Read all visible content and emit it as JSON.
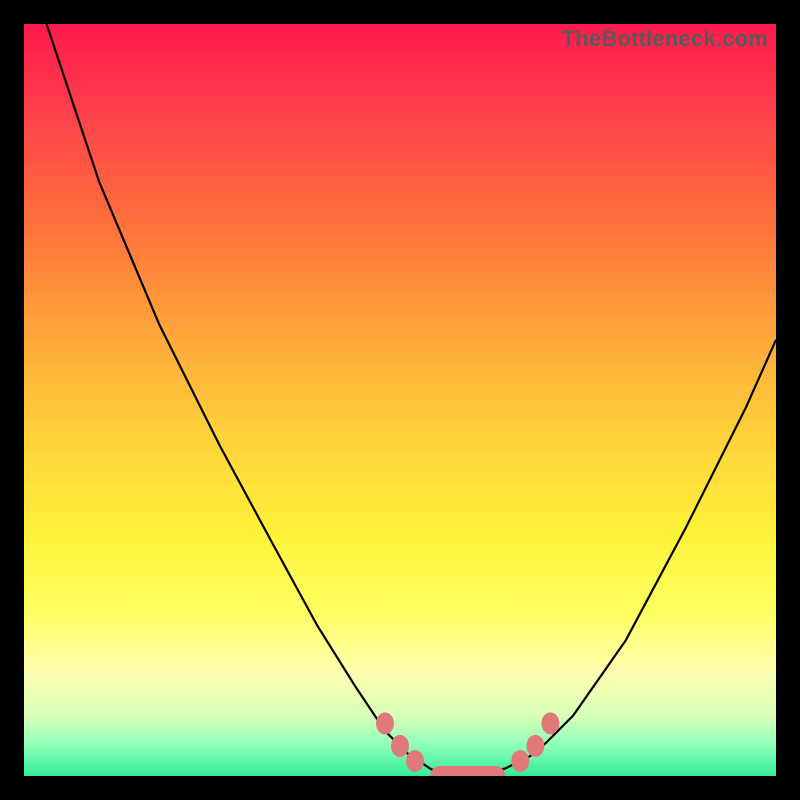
{
  "watermark": "TheBottleneck.com",
  "colors": {
    "background": "#000000",
    "gradient_top": "#ff1a4d",
    "gradient_bottom": "#33eb99",
    "curve": "#000000",
    "marker": "#e07a7a"
  },
  "chart_data": {
    "type": "line",
    "title": "",
    "xlabel": "",
    "ylabel": "",
    "xlim": [
      0,
      100
    ],
    "ylim": [
      0,
      100
    ],
    "grid": false,
    "legend": false,
    "series": [
      {
        "name": "curve",
        "x": [
          3,
          10,
          18,
          26,
          33,
          39,
          44,
          48,
          51,
          54,
          56,
          60,
          64,
          68,
          73,
          80,
          88,
          96,
          100
        ],
        "values": [
          100,
          79,
          60,
          44,
          31,
          20,
          12,
          6,
          3,
          1,
          0,
          0,
          1,
          3,
          8,
          18,
          33,
          49,
          58
        ]
      }
    ],
    "annotations": {
      "marker_points": [
        {
          "x": 48,
          "y": 7
        },
        {
          "x": 50,
          "y": 4
        },
        {
          "x": 52,
          "y": 2
        },
        {
          "x": 66,
          "y": 2
        },
        {
          "x": 68,
          "y": 4
        },
        {
          "x": 70,
          "y": 7
        }
      ],
      "flat_segment": {
        "x_start": 54,
        "x_end": 64,
        "y": 0
      }
    }
  }
}
